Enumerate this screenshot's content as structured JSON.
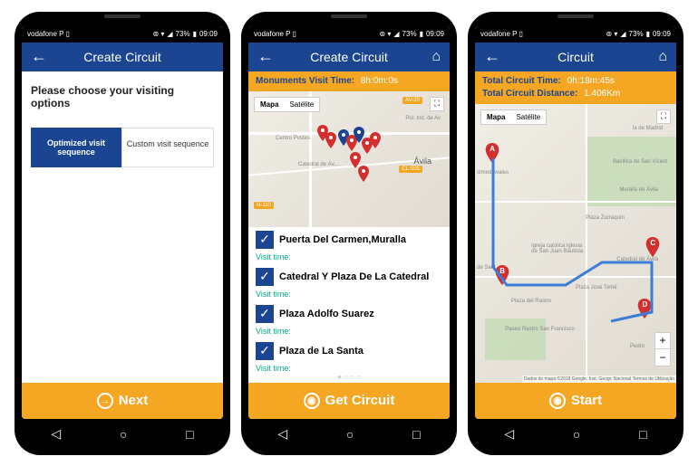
{
  "status": {
    "carrier": "vodafone P",
    "battery": "73%",
    "time": "09:09"
  },
  "screen1": {
    "title": "Create Circuit",
    "prompt": "Please choose your visiting options",
    "tab_active": "Optimized visit sequence",
    "tab_inactive": "Custom visit sequence",
    "action": "Next"
  },
  "screen2": {
    "title": "Create Circuit",
    "info_label": "Monuments Visit Time:",
    "info_value": "8h:0m:0s",
    "map_tab1": "Mapa",
    "map_tab2": "Satélite",
    "road1": "AV-20",
    "road2": "N-110",
    "road3": "CL-505",
    "city": "Ávila",
    "place1": "Catedral de Áv...",
    "place2": "Pol. Ind. de Av",
    "place3": "Centro Postes",
    "items": [
      "Puerta Del Carmen,Muralla",
      "Catedral Y Plaza De La Catedral",
      "Plaza Adolfo Suarez",
      "Plaza de La Santa"
    ],
    "visit_time": "Visit time:",
    "action": "Get Circuit"
  },
  "screen3": {
    "title": "Circuit",
    "time_label": "Total Circuit Time:",
    "time_value": "0h:18m:45s",
    "dist_label": "Total Circuit Distance:",
    "dist_value": "1.406Km",
    "map_tab1": "Mapa",
    "map_tab2": "Satélite",
    "places": {
      "p1": "la de Madrid",
      "p2": "Basílica de San Vicent",
      "p3": "Muralla de Ávila",
      "p4": "Plaza Zurraquín",
      "p5": "Igreja católica Iglesia de San Juan Bautista",
      "p6": "Catedral de Ávila",
      "p7": "Plaza José Tomé",
      "p8": "Plaza del Rastro",
      "p9": "Paseo Rastro San Francisco",
      "p10": "stmedievales",
      "p11": "Pedro",
      "p12": "de Sant"
    },
    "attribution": "Dados do mapa ©2018 Google, Inst. Geogr. Nacional   Termos de Utilização",
    "action": "Start"
  }
}
